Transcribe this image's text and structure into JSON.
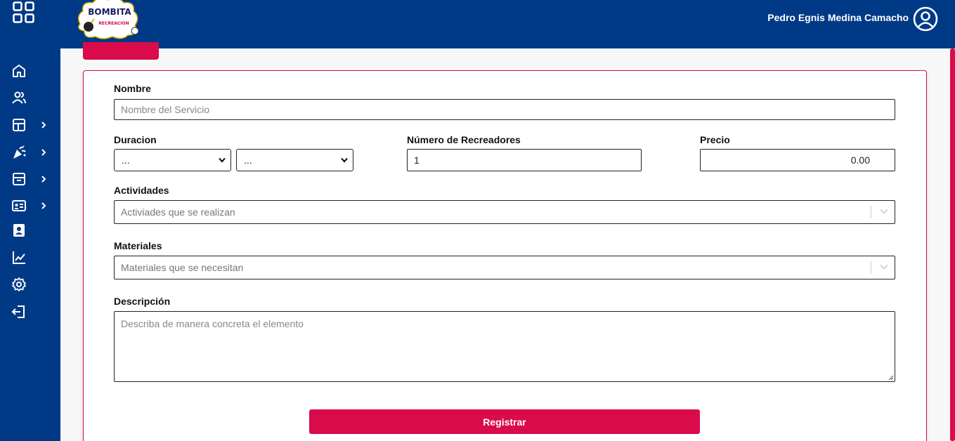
{
  "header": {
    "user_name": "Pedro Egnis Medina Camacho",
    "logo_text_top": "BOMBITA",
    "logo_text_bottom": "RECREACION"
  },
  "sidebar": {
    "items": [
      {
        "icon": "home-icon"
      },
      {
        "icon": "users-icon"
      },
      {
        "icon": "layout-icon",
        "expandable": true
      },
      {
        "icon": "party-icon",
        "expandable": true
      },
      {
        "icon": "archive-icon",
        "expandable": true
      },
      {
        "icon": "id-card-icon",
        "expandable": true
      },
      {
        "icon": "contacts-icon"
      },
      {
        "icon": "chart-icon"
      },
      {
        "icon": "settings-icon"
      },
      {
        "icon": "logout-icon"
      }
    ]
  },
  "form": {
    "nombre_label": "Nombre",
    "nombre_placeholder": "Nombre del Servicio",
    "duracion_label": "Duracion",
    "duracion_select_1": "...",
    "duracion_select_2": "...",
    "recreadores_label": "Número de Recreadores",
    "recreadores_value": "1",
    "precio_label": "Precio",
    "precio_value": "0.00",
    "actividades_label": "Actividades",
    "actividades_placeholder": "Activiades que se realizan",
    "materiales_label": "Materiales",
    "materiales_placeholder": "Materiales que se necesitan",
    "descripcion_label": "Descripción",
    "descripcion_placeholder": "Describa de manera concreta el elemento",
    "submit_label": "Registrar"
  },
  "colors": {
    "primary": "#003a86",
    "accent": "#d90b4a"
  }
}
